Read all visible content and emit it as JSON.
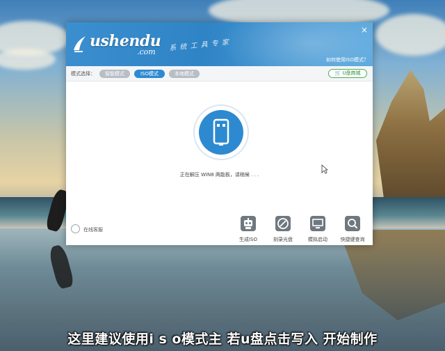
{
  "window": {
    "brand": "ushendu",
    "brand_domain": ".com",
    "slogan": "系 统 工 具 专 家",
    "close_label": "×",
    "iso_help_link": "如何使用ISO模式？"
  },
  "mode_bar": {
    "label": "模式选择：",
    "modes": [
      {
        "label": "智能模式",
        "active": false
      },
      {
        "label": "ISO模式",
        "active": true
      },
      {
        "label": "本地模式",
        "active": false
      }
    ],
    "shop_label": "U盘商城"
  },
  "main": {
    "icon": "usb-drive-icon",
    "status_text": "正在解压 WIN8 两能板，请稍候 . . ."
  },
  "bottom": {
    "online_service_label": "在线客服",
    "tools": [
      {
        "label": "生成ISO",
        "icon": "robot-icon"
      },
      {
        "label": "刻录光盘",
        "icon": "disc-icon"
      },
      {
        "label": "模拟启动",
        "icon": "monitor-icon"
      },
      {
        "label": "快捷键查询",
        "icon": "magnifier-icon"
      }
    ]
  },
  "subtitle": "这里建议使用i s o模式主 若u盘点击写入 开始制作",
  "colors": {
    "titlebar": "#2f84c6",
    "accent": "#2d8ad0",
    "shop_green": "#4caf50",
    "tool_icon": "#6f7880"
  }
}
